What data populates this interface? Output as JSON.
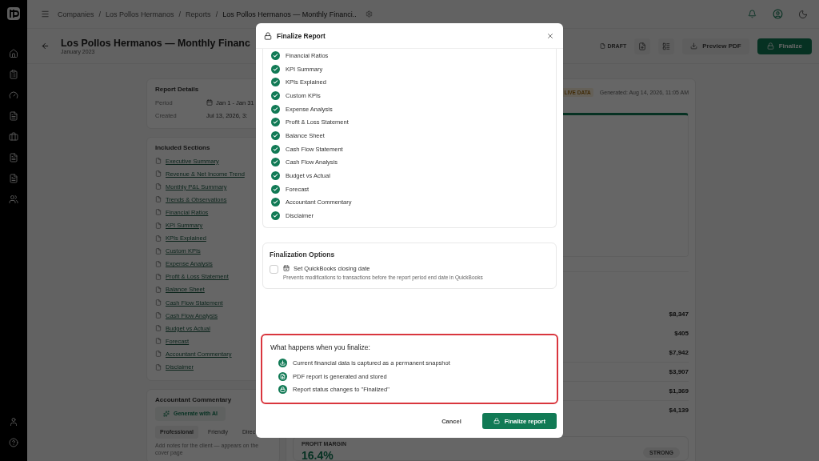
{
  "breadcrumb": {
    "separator": "/",
    "items": [
      "Companies",
      "Los Pollos Hermanos",
      "Reports",
      "Los Pollos Hermanos — Monthly Financi.."
    ]
  },
  "header": {
    "title": "Los Pollos Hermanos — Monthly Financ",
    "subtitle": "January 2023",
    "status": "DRAFT",
    "preview_button": "Preview PDF",
    "finalize_button": "Finalize"
  },
  "report_details": {
    "title": "Report Details",
    "rows": [
      {
        "label": "Period",
        "value": "Jan 1 - Jan 31",
        "kind": "date"
      },
      {
        "label": "Created",
        "value": "Jul 13, 2026, 3:",
        "kind": "plain"
      }
    ]
  },
  "included_sections": {
    "title": "Included Sections",
    "items": [
      "Executive Summary",
      "Revenue & Net Income Trend",
      "Monthly P&L Summary",
      "Trends & Observations",
      "Financial Ratios",
      "KPI Summary",
      "KPIs Explained",
      "Custom KPIs",
      "Expense Analysis",
      "Profit & Loss Statement",
      "Balance Sheet",
      "Cash Flow Statement",
      "Cash Flow Analysis",
      "Budget vs Actual",
      "Forecast",
      "Accountant Commentary",
      "Disclaimer"
    ]
  },
  "commentary": {
    "title": "Accountant Commentary",
    "generate_button": "Generate with AI",
    "tabs": [
      {
        "label": "Professional",
        "selected": true
      },
      {
        "label": "Friendly",
        "selected": false
      },
      {
        "label": "Direc",
        "selected": false
      }
    ],
    "hint": "Add notes for the client — appears on the cover page"
  },
  "preview": {
    "badge": "LIVE DATA",
    "generated": "Generated: Aug 14, 2026, 11:05 AM",
    "values": [
      "$8,347",
      "$405",
      "$7,942",
      "$3,907",
      "$1,369",
      "$4,139"
    ],
    "metric": {
      "label": "PROFIT MARGIN",
      "value": "16.4%",
      "rating": "STRONG"
    }
  },
  "dialog": {
    "title": "Finalize Report",
    "sections": [
      {
        "label": "Financial Ratios",
        "checked": true
      },
      {
        "label": "KPI Summary",
        "checked": true
      },
      {
        "label": "KPIs Explained",
        "checked": true
      },
      {
        "label": "Custom KPIs",
        "checked": true
      },
      {
        "label": "Expense Analysis",
        "checked": true
      },
      {
        "label": "Profit & Loss Statement",
        "checked": true
      },
      {
        "label": "Balance Sheet",
        "checked": true
      },
      {
        "label": "Cash Flow Statement",
        "checked": true
      },
      {
        "label": "Cash Flow Analysis",
        "checked": true
      },
      {
        "label": "Budget vs Actual",
        "checked": true
      },
      {
        "label": "Forecast",
        "checked": true
      },
      {
        "label": "Accountant Commentary",
        "checked": true
      },
      {
        "label": "Disclaimer",
        "checked": true
      }
    ],
    "options": {
      "title": "Finalization Options",
      "items": [
        {
          "label": "Set QuickBooks closing date",
          "description": "Prevents modifications to transactions before the report period end date in QuickBooks",
          "checked": false
        }
      ]
    },
    "notice": {
      "title": "What happens when you finalize:",
      "items": [
        {
          "text": "Current financial data is captured as a permanent snapshot",
          "kind": "download"
        },
        {
          "text": "PDF report is generated and stored",
          "kind": "pdf"
        },
        {
          "text": "Report status changes to \"Finalized\"",
          "kind": "lock"
        }
      ]
    },
    "buttons": {
      "cancel": "Cancel",
      "confirm": "Finalize report"
    }
  }
}
